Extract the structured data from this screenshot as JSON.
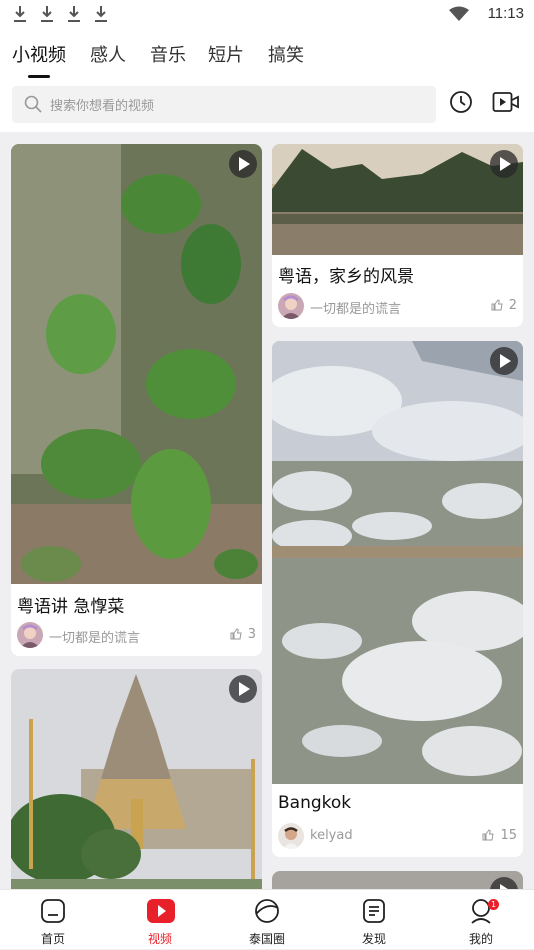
{
  "status_bar": {
    "time": "11:13"
  },
  "tabs": [
    {
      "label": "小视频",
      "active": true
    },
    {
      "label": "感人"
    },
    {
      "label": "音乐"
    },
    {
      "label": "短片"
    },
    {
      "label": "搞笑"
    }
  ],
  "search": {
    "placeholder": "搜索你想看的视频"
  },
  "cards": [
    {
      "title": "粤语讲 急惸菜",
      "user": "一切都是的谎言",
      "likes": "3"
    },
    {
      "title": "粤语，家乡的风景",
      "user": "一切都是的谎言",
      "likes": "2"
    },
    {
      "title": "Bangkok",
      "user": "kelyad",
      "likes": "15"
    }
  ],
  "bottom_nav": [
    {
      "label": "首页",
      "icon": "home-icon"
    },
    {
      "label": "视频",
      "icon": "video-icon",
      "active": true
    },
    {
      "label": "泰国圈",
      "icon": "circle-icon"
    },
    {
      "label": "发现",
      "icon": "discover-icon"
    },
    {
      "label": "我的",
      "icon": "profile-icon",
      "badge": "1"
    }
  ],
  "colors": {
    "accent": "#e8202a",
    "background": "#efeff1"
  }
}
